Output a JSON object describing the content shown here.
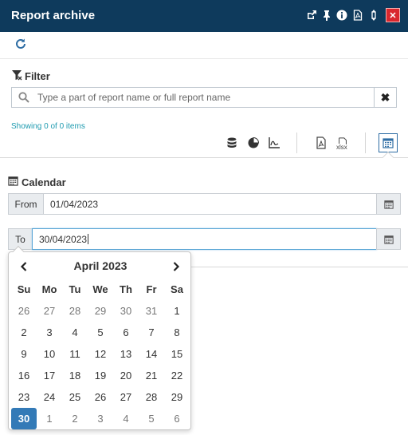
{
  "window": {
    "title": "Report archive",
    "header_icons": [
      "external-link-icon",
      "pin-icon",
      "info-icon",
      "pdf-icon",
      "resize-icon"
    ],
    "close_label": "✕"
  },
  "filter": {
    "label": "Filter",
    "placeholder": "Type a part of report name or full report name",
    "value": "",
    "clear_label": "✖"
  },
  "status": {
    "showing": "Showing 0 of 0 items"
  },
  "toolbar": {
    "icons": [
      "database-icon",
      "pie-chart-icon",
      "line-chart-icon",
      "pdf-file-icon",
      "xlsx-file-icon",
      "calendar-icon"
    ],
    "xlsx_label": "xlsx"
  },
  "calendar": {
    "label": "Calendar",
    "from_label": "From",
    "from_value": "01/04/2023",
    "to_label": "To",
    "to_value": "30/04/2023"
  },
  "datepicker": {
    "month_year": "April 2023",
    "weekdays": [
      "Su",
      "Mo",
      "Tu",
      "We",
      "Th",
      "Fr",
      "Sa"
    ],
    "weeks": [
      [
        {
          "d": "26",
          "m": true
        },
        {
          "d": "27",
          "m": true
        },
        {
          "d": "28",
          "m": true
        },
        {
          "d": "29",
          "m": true
        },
        {
          "d": "30",
          "m": true
        },
        {
          "d": "31",
          "m": true
        },
        {
          "d": "1"
        }
      ],
      [
        {
          "d": "2"
        },
        {
          "d": "3"
        },
        {
          "d": "4"
        },
        {
          "d": "5"
        },
        {
          "d": "6"
        },
        {
          "d": "7"
        },
        {
          "d": "8"
        }
      ],
      [
        {
          "d": "9"
        },
        {
          "d": "10"
        },
        {
          "d": "11"
        },
        {
          "d": "12"
        },
        {
          "d": "13"
        },
        {
          "d": "14"
        },
        {
          "d": "15"
        }
      ],
      [
        {
          "d": "16"
        },
        {
          "d": "17"
        },
        {
          "d": "18"
        },
        {
          "d": "19"
        },
        {
          "d": "20"
        },
        {
          "d": "21"
        },
        {
          "d": "22"
        }
      ],
      [
        {
          "d": "23"
        },
        {
          "d": "24"
        },
        {
          "d": "25"
        },
        {
          "d": "26"
        },
        {
          "d": "27"
        },
        {
          "d": "28"
        },
        {
          "d": "29"
        }
      ],
      [
        {
          "d": "30",
          "sel": true
        },
        {
          "d": "1",
          "m": true
        },
        {
          "d": "2",
          "m": true
        },
        {
          "d": "3",
          "m": true
        },
        {
          "d": "4",
          "m": true
        },
        {
          "d": "5",
          "m": true
        },
        {
          "d": "6",
          "m": true
        }
      ]
    ]
  },
  "colors": {
    "header_bg": "#0e3a5c",
    "close_bg": "#d9272e",
    "accent": "#337ab7",
    "link": "#1f9bb0"
  }
}
